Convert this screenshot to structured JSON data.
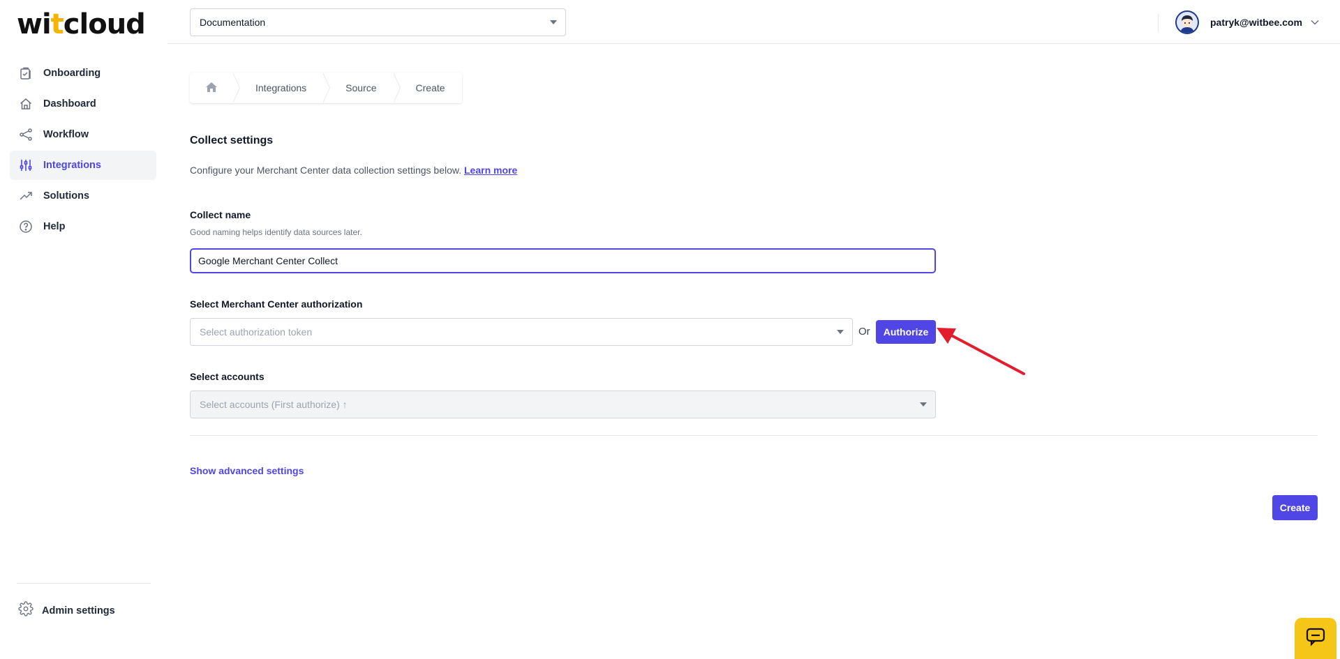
{
  "brand": {
    "logo_prefix": "wi",
    "logo_accent": "t",
    "logo_suffix": "cloud",
    "accent_color": "#f5b400",
    "primary_color": "#4f46e5"
  },
  "sidebar": {
    "items": [
      {
        "label": "Onboarding",
        "icon": "clipboard-check-icon",
        "active": false
      },
      {
        "label": "Dashboard",
        "icon": "home-icon",
        "active": false
      },
      {
        "label": "Workflow",
        "icon": "share-nodes-icon",
        "active": false
      },
      {
        "label": "Integrations",
        "icon": "sliders-icon",
        "active": true
      },
      {
        "label": "Solutions",
        "icon": "trending-up-icon",
        "active": false
      },
      {
        "label": "Help",
        "icon": "question-circle-icon",
        "active": false
      }
    ],
    "admin_label": "Admin settings"
  },
  "topbar": {
    "project": "Documentation",
    "user_email": "patryk@witbee.com"
  },
  "breadcrumb": {
    "items": [
      "Integrations",
      "Source",
      "Create"
    ]
  },
  "form": {
    "title": "Collect settings",
    "description": "Configure your Merchant Center data collection settings below.",
    "learn_more": "Learn more",
    "collect_name_label": "Collect name",
    "collect_name_hint": "Good naming helps identify data sources later.",
    "collect_name_value": "Google Merchant Center Collect",
    "auth_label": "Select Merchant Center authorization",
    "auth_placeholder": "Select authorization token",
    "or_text": "Or",
    "authorize_button": "Authorize",
    "accounts_label": "Select accounts",
    "accounts_placeholder": "Select accounts (First authorize) ↑",
    "advanced_link": "Show advanced settings",
    "create_button": "Create"
  },
  "annotation": {
    "arrow_color": "#e11d2e"
  }
}
